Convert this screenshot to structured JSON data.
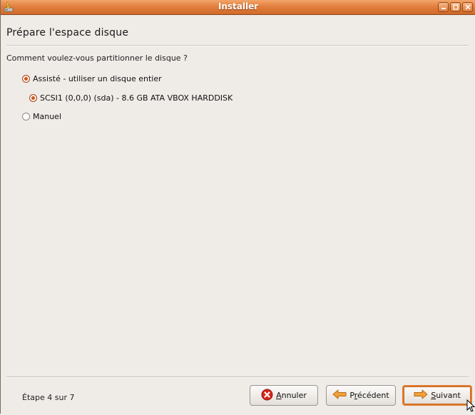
{
  "window": {
    "title": "Installer"
  },
  "page": {
    "title": "Prépare l'espace disque",
    "question": "Comment voulez-vous partitionner le disque ?"
  },
  "options": [
    {
      "label": "Assisté - utiliser un disque entier",
      "checked": true
    },
    {
      "label": "SCSI1 (0,0,0) (sda) - 8.6 GB ATA VBOX HARDDISK",
      "checked": true
    },
    {
      "label": "Manuel",
      "checked": false
    }
  ],
  "footer": {
    "step": "Étape 4 sur 7",
    "cancel_mnemonic": "A",
    "cancel_rest": "nnuler",
    "back_first": "P",
    "back_mnemonic": "r",
    "back_rest": "écédent",
    "next_mnemonic": "S",
    "next_rest": "uivant"
  },
  "colors": {
    "titlebar": "#e3803f",
    "accent": "#e07b2d",
    "background": "#efebe7"
  },
  "icons": [
    "app-icon",
    "minimize-icon",
    "maximize-icon",
    "close-icon",
    "cancel-icon",
    "back-arrow-icon",
    "forward-arrow-icon",
    "mouse-cursor-icon"
  ]
}
